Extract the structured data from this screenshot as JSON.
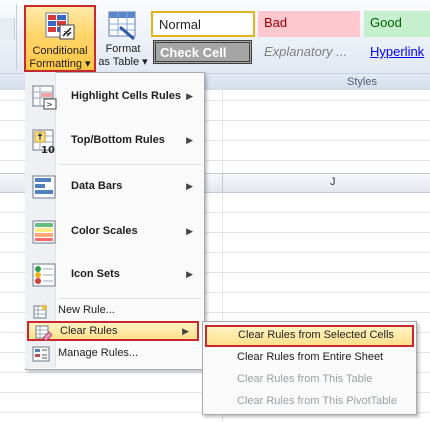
{
  "ribbon": {
    "conditional_formatting": {
      "line1": "Conditional",
      "line2": "Formatting",
      "dropdown": "▾"
    },
    "format_as_table": {
      "line1": "Format",
      "line2": "as Table",
      "dropdown": "▾"
    },
    "styles": [
      {
        "label": "Normal",
        "bg": "#ffffff",
        "fg": "#1e1e1e",
        "border": "#e1b31c"
      },
      {
        "label": "Bad",
        "bg": "#ffc7ce",
        "fg": "#9c0006"
      },
      {
        "label": "Good",
        "bg": "#c6efce",
        "fg": "#006100"
      },
      {
        "label": "Check Cell",
        "bg": "#a5a5a5",
        "fg": "#ffffff"
      },
      {
        "label": "Explanatory ...",
        "bg": "#ffffff",
        "fg": "#7f7f7f"
      },
      {
        "label": "Hyperlink",
        "bg": "#ffffff",
        "fg": "#0000ff"
      }
    ],
    "group_styles": "Styles"
  },
  "grid": {
    "column_j": "J"
  },
  "menu": {
    "items": [
      {
        "label": "Highlight Cells Rules",
        "icon": "highlight-cells-icon"
      },
      {
        "label": "Top/Bottom Rules",
        "icon": "top-bottom-icon"
      },
      {
        "label": "Data Bars",
        "icon": "data-bars-icon"
      },
      {
        "label": "Color Scales",
        "icon": "color-scales-icon"
      },
      {
        "label": "Icon Sets",
        "icon": "icon-sets-icon"
      }
    ],
    "new_rule": "New Rule...",
    "clear_rules": "Clear Rules",
    "manage_rules": "Manage Rules...",
    "arrow": "▶"
  },
  "submenu": {
    "items": [
      {
        "label": "Clear Rules from Selected Cells",
        "enabled": true
      },
      {
        "label": "Clear Rules from Entire Sheet",
        "enabled": true
      },
      {
        "label": "Clear Rules from This Table",
        "enabled": false
      },
      {
        "label": "Clear Rules from This PivotTable",
        "enabled": false
      }
    ]
  },
  "colors": {
    "highlight": "#ffe08a",
    "annotation_red": "#c7292f"
  }
}
